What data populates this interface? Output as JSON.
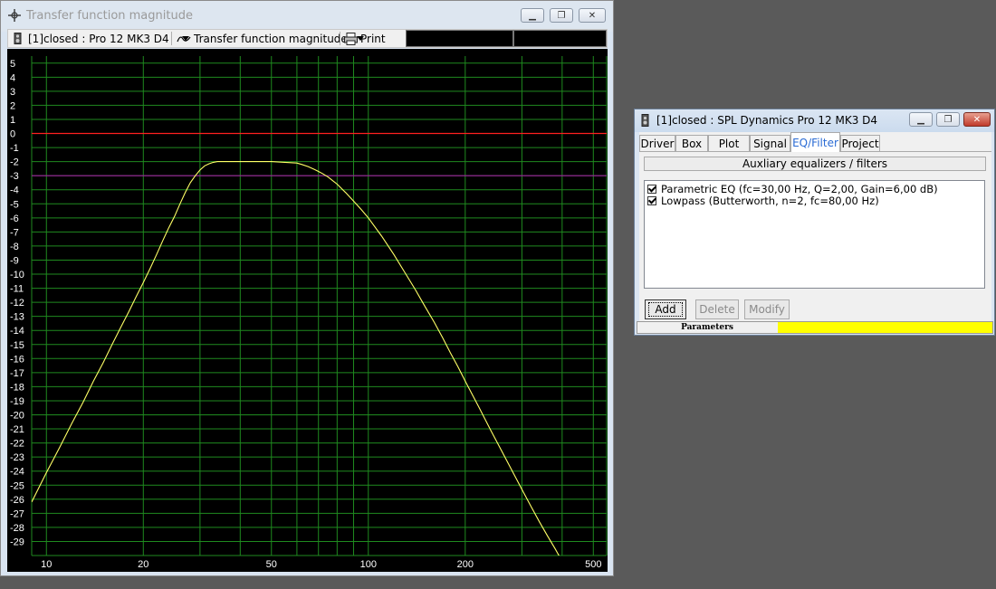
{
  "plot_window": {
    "title": "Transfer function magnitude",
    "toolbar": {
      "project_select": "[1]closed : Pro 12 MK3 D4",
      "curve_select": "Transfer function magnitude",
      "print_label": "Print"
    }
  },
  "chart_data": {
    "type": "line",
    "xscale": "log",
    "xlim": [
      9,
      550
    ],
    "ylim": [
      -30,
      5.5
    ],
    "x_tick_labels": [
      {
        "value": 10,
        "label": "10"
      },
      {
        "value": 20,
        "label": "20"
      },
      {
        "value": 50,
        "label": "50"
      },
      {
        "value": 100,
        "label": "100"
      },
      {
        "value": 200,
        "label": "200"
      },
      {
        "value": 500,
        "label": "500"
      }
    ],
    "y_ticks": [
      5,
      4,
      3,
      2,
      1,
      0,
      -1,
      -2,
      -3,
      -4,
      -5,
      -6,
      -7,
      -8,
      -9,
      -10,
      -11,
      -12,
      -13,
      -14,
      -15,
      -16,
      -17,
      -18,
      -19,
      -20,
      -21,
      -22,
      -23,
      -24,
      -25,
      -26,
      -27,
      -28,
      -29
    ],
    "grid": true,
    "reference_lines": [
      {
        "y": 0,
        "color": "#ff2020"
      },
      {
        "y": -3,
        "color": "#a020a0"
      }
    ],
    "series": [
      {
        "color": "#ffff66",
        "x": [
          9,
          10,
          11,
          12,
          13,
          14,
          15,
          16,
          17,
          18,
          19,
          20,
          21,
          22,
          23,
          24,
          25,
          26,
          27,
          28,
          29,
          30,
          31,
          32,
          33,
          34,
          35,
          36,
          38,
          40,
          45,
          50,
          55,
          60,
          62,
          65,
          68,
          70,
          72,
          75,
          78,
          80,
          85,
          90,
          95,
          100,
          110,
          120,
          130,
          140,
          150,
          160,
          170,
          180,
          190,
          200,
          220,
          240,
          260,
          280,
          300,
          320,
          340,
          360,
          380,
          400,
          420,
          440,
          460,
          480,
          500
        ],
        "y": [
          -26.2,
          -24.1,
          -22.3,
          -20.6,
          -19.1,
          -17.6,
          -16.3,
          -15.0,
          -13.8,
          -12.7,
          -11.6,
          -10.6,
          -9.6,
          -8.6,
          -7.6,
          -6.7,
          -5.9,
          -5.0,
          -4.2,
          -3.5,
          -3.0,
          -2.6,
          -2.3,
          -2.15,
          -2.05,
          -2.0,
          -2.0,
          -2.0,
          -2.0,
          -2.0,
          -2.0,
          -2.0,
          -2.05,
          -2.1,
          -2.2,
          -2.35,
          -2.55,
          -2.7,
          -2.85,
          -3.1,
          -3.4,
          -3.6,
          -4.2,
          -4.8,
          -5.4,
          -6.0,
          -7.3,
          -8.6,
          -9.9,
          -11.1,
          -12.3,
          -13.4,
          -14.5,
          -15.6,
          -16.6,
          -17.6,
          -19.4,
          -21.1,
          -22.6,
          -24.0,
          -25.3,
          -26.5,
          -27.6,
          -28.6,
          -29.5,
          -30.4,
          -31.2,
          -32.0,
          -32.7,
          -33.4,
          -34.0
        ]
      }
    ]
  },
  "props_window": {
    "title": "[1]closed : SPL Dynamics Pro 12 MK3 D4",
    "tabs": [
      {
        "label": "Driver"
      },
      {
        "label": "Box"
      },
      {
        "label": "Plot"
      },
      {
        "label": "Signal"
      },
      {
        "label": "EQ/Filter"
      },
      {
        "label": "Project"
      }
    ],
    "active_tab": "EQ/Filter",
    "group_label": "Auxliary equalizers / filters",
    "filters": [
      {
        "label": "Parametric EQ (fc=30,00 Hz, Q=2,00, Gain=6,00 dB)",
        "checked": true
      },
      {
        "label": "Lowpass (Butterworth, n=2, fc=80,00 Hz)",
        "checked": true
      }
    ],
    "buttons": {
      "add": "Add",
      "delete": "Delete",
      "modify": "Modify"
    },
    "status": {
      "label": "Parameters",
      "bar_color": "#ffff00"
    }
  },
  "colors": {
    "grid": "#1f8a1f",
    "plot_bg": "#000000",
    "axis_text": "#ffffff"
  }
}
